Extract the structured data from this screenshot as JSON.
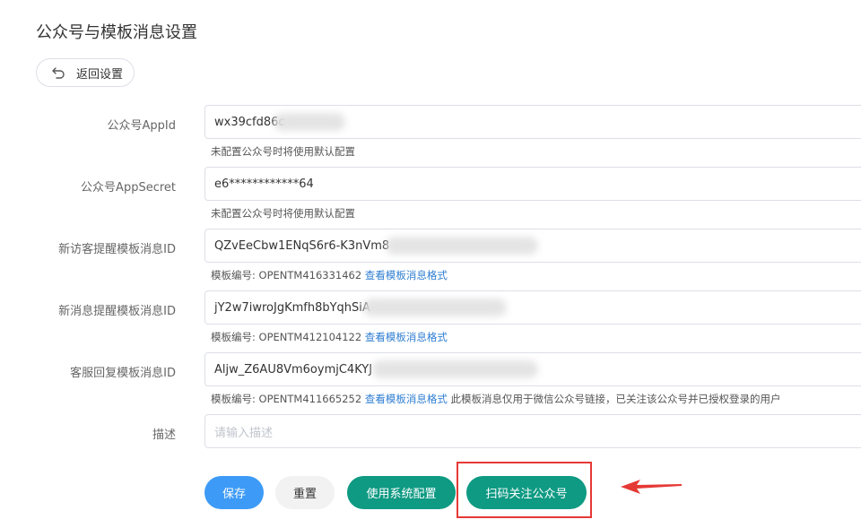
{
  "page": {
    "title": "公众号与模板消息设置"
  },
  "back": {
    "label": "返回设置",
    "icon": "undo-arrow-icon"
  },
  "form": {
    "appid": {
      "label": "公众号AppId",
      "value": "wx39cfd86c",
      "helper": "未配置公众号时将使用默认配置"
    },
    "appsecret": {
      "label": "公众号AppSecret",
      "value": "e6************64",
      "helper": "未配置公众号时将使用默认配置"
    },
    "visitor_tpl": {
      "label": "新访客提醒模板消息ID",
      "value": "QZvEeCbw1ENqS6r6-K3nVm8",
      "helper_prefix": "模板编号: OPENTM416331462",
      "helper_link": "查看模板消息格式"
    },
    "message_tpl": {
      "label": "新消息提醒模板消息ID",
      "value": "jY2w7iwroJgKmfh8bYqhSiA",
      "helper_prefix": "模板编号: OPENTM412104122",
      "helper_link": "查看模板消息格式"
    },
    "reply_tpl": {
      "label": "客服回复模板消息ID",
      "value": "Aljw_Z6AU8Vm6oymjC4KYJ",
      "helper_prefix": "模板编号: OPENTM411665252",
      "helper_link": "查看模板消息格式",
      "helper_suffix": "此模板消息仅用于微信公众号链接，已关注该公众号并已授权登录的用户"
    },
    "description": {
      "label": "描述",
      "placeholder": "请输入描述",
      "value": ""
    }
  },
  "actions": {
    "save": "保存",
    "reset": "重置",
    "use_system": "使用系统配置",
    "scan_follow": "扫码关注公众号"
  },
  "colors": {
    "primary": "#3d9bf7",
    "teal": "#0e9a83",
    "link": "#2e7dd1",
    "highlight": "#e53935"
  }
}
